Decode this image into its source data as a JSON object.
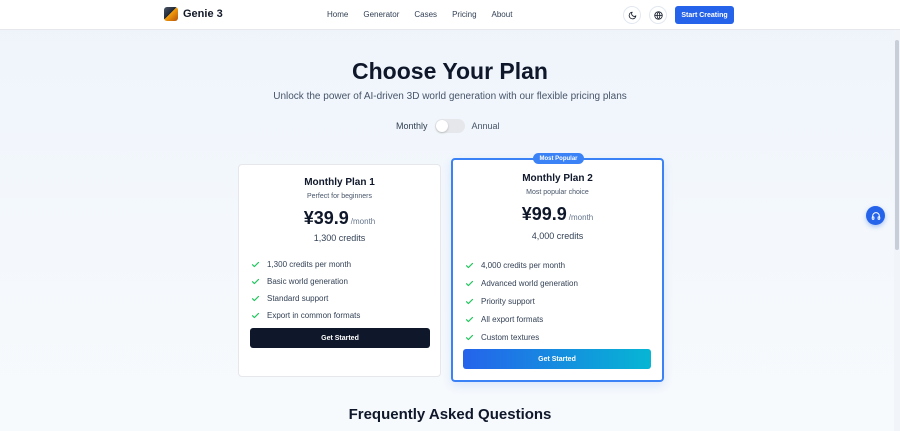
{
  "header": {
    "brand_name": "Genie 3",
    "logo_icon": "game-logo-icon",
    "nav": [
      {
        "label": "Home"
      },
      {
        "label": "Generator"
      },
      {
        "label": "Cases"
      },
      {
        "label": "Pricing"
      },
      {
        "label": "About"
      }
    ],
    "theme_icon": "moon-icon",
    "language_icon": "globe-icon",
    "cta_label": "Start Creating",
    "accent_color": "#2563eb"
  },
  "hero": {
    "title": "Choose Your Plan",
    "subtitle": "Unlock the power of AI-driven 3D world generation with our flexible pricing plans"
  },
  "billing_toggle": {
    "left_label": "Monthly",
    "right_label": "Annual",
    "annual_selected": false
  },
  "plans": [
    {
      "name": "Monthly Plan 1",
      "tagline": "Perfect for beginners",
      "price": "¥39.9",
      "period": "/month",
      "credits": "1,300 credits",
      "features": [
        "1,300 credits per month",
        "Basic world generation",
        "Standard support",
        "Export in common formats"
      ],
      "button_label": "Get Started",
      "button_color": "#0f172a"
    },
    {
      "badge": "Most Popular",
      "name": "Monthly Plan 2",
      "tagline": "Most popular choice",
      "price": "¥99.9",
      "period": "/month",
      "credits": "4,000 credits",
      "features": [
        "4,000 credits per month",
        "Advanced world generation",
        "Priority support",
        "All export formats",
        "Custom textures"
      ],
      "button_label": "Get Started",
      "highlight_color": "#3b82f6"
    }
  ],
  "faq": {
    "title": "Frequently Asked Questions"
  },
  "support_button_icon": "headset-icon",
  "check_color": "#22c55e"
}
